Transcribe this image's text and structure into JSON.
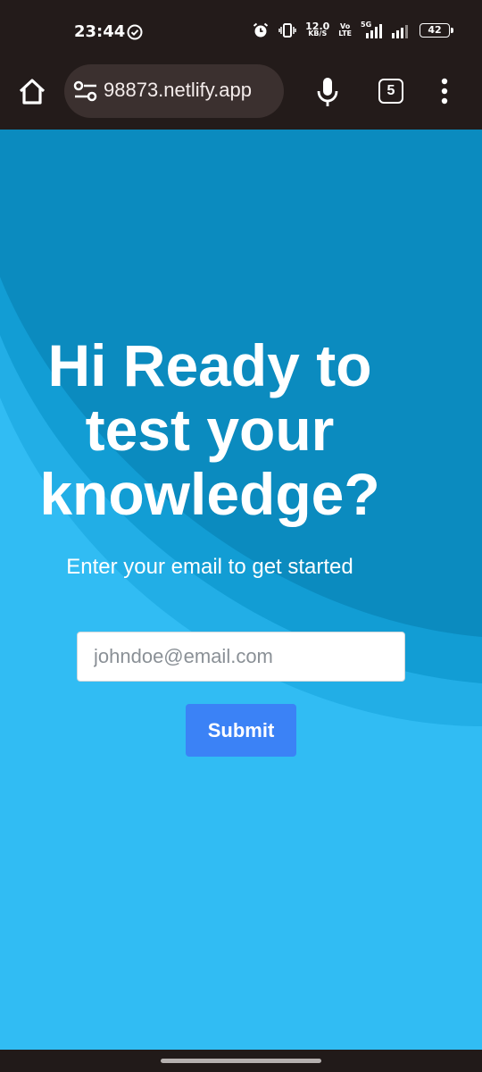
{
  "status_bar": {
    "time": "23:44",
    "speed_value": "12.0",
    "speed_unit": "KB/S",
    "volte_top": "Vo",
    "volte_bottom": "LTE",
    "network": "5G",
    "battery": "42",
    "icons": [
      "check-circle-icon",
      "alarm-icon",
      "vibrate-icon",
      "signal-icon",
      "battery-icon"
    ]
  },
  "browser": {
    "url": "98873.netlify.app",
    "tab_count": "5",
    "icons": [
      "home-icon",
      "tune-icon",
      "mic-icon",
      "more-vert-icon"
    ]
  },
  "page": {
    "heading_line1": "Hi Ready to",
    "heading_line2": "test your",
    "heading_line3": "knowledge?",
    "subheading": "Enter your email to get started",
    "email_placeholder": "johndoe@email.com",
    "email_value": "",
    "submit_label": "Submit"
  },
  "colors": {
    "background": "#31bcf3",
    "wave_dark": "#0b8bbf",
    "wave_mid": "#129dd4",
    "wave_light": "#22aee6",
    "button": "#3b82f6",
    "chrome": "#231b1a"
  }
}
